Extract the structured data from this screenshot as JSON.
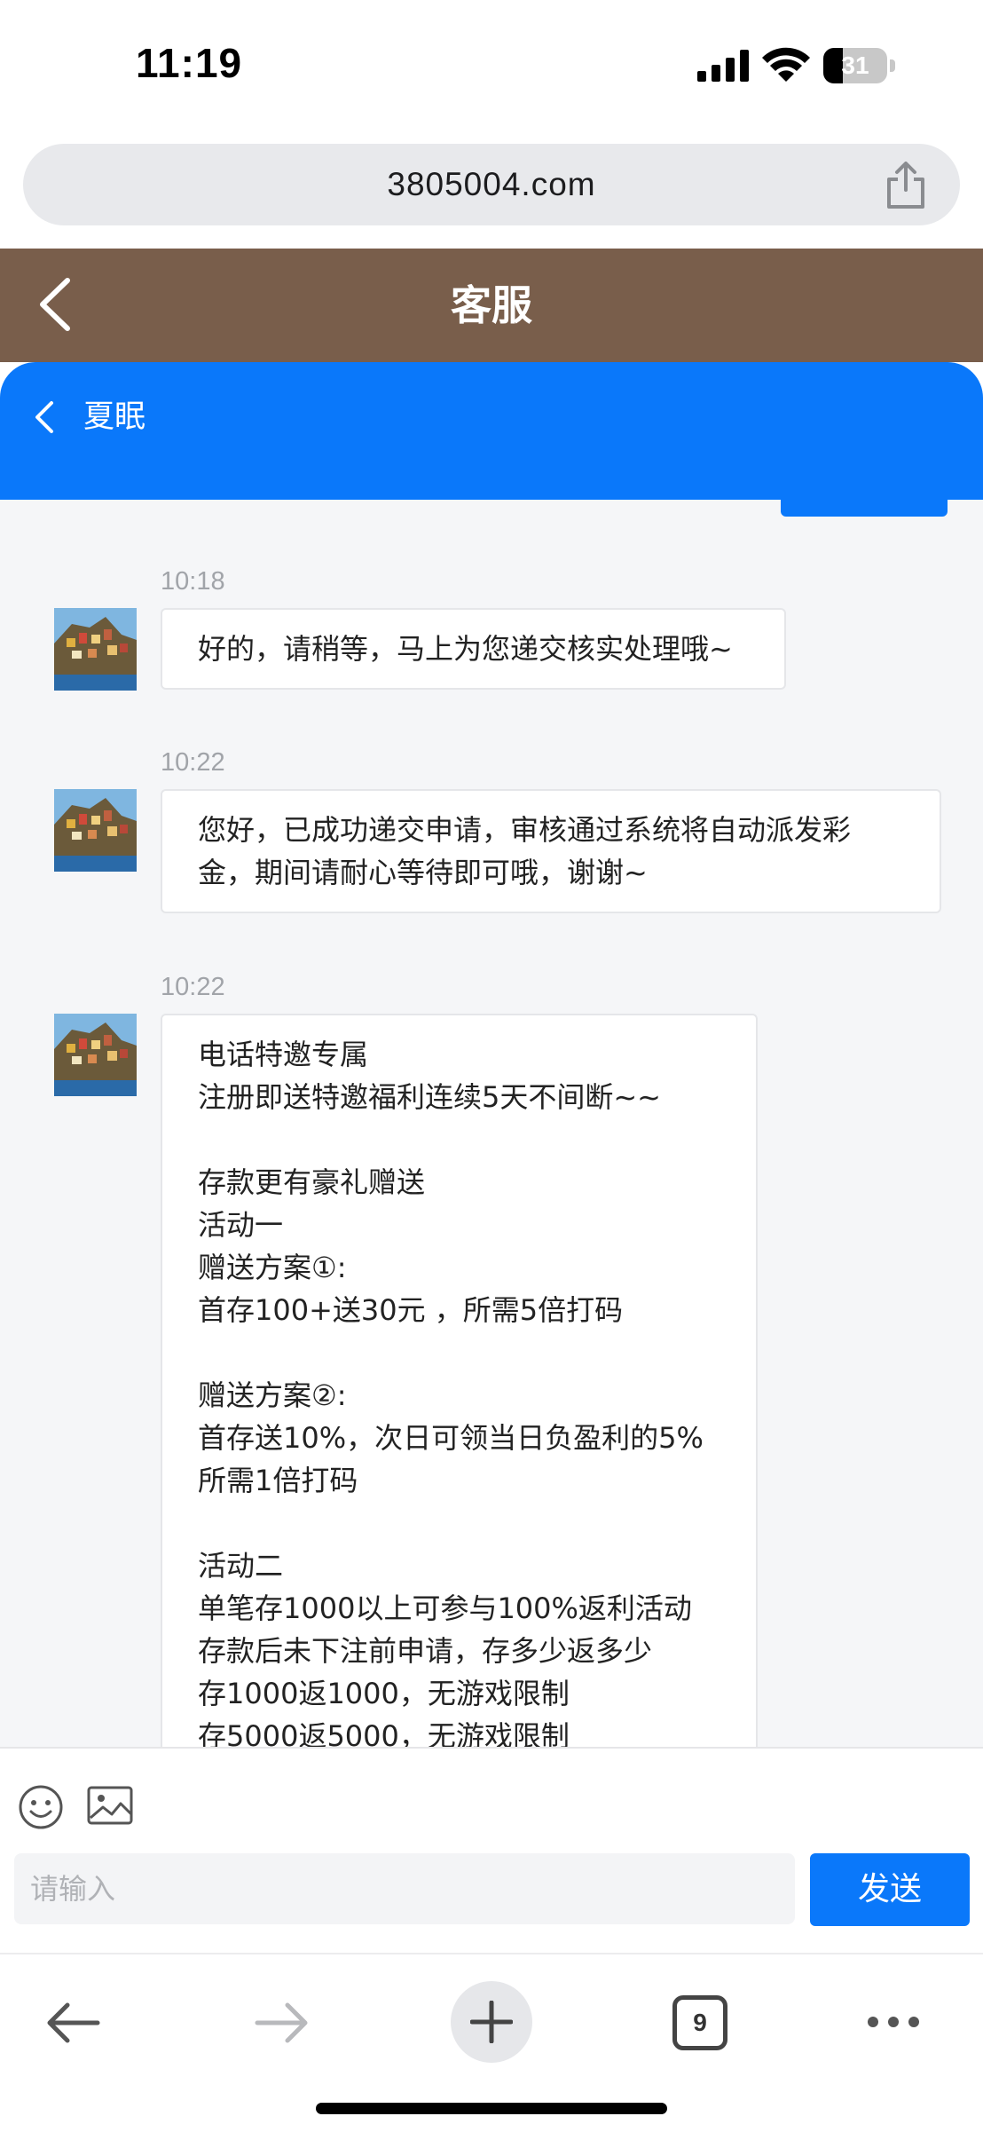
{
  "status_bar": {
    "time": "11:19",
    "battery": "31",
    "battery_level": 0.31
  },
  "browser": {
    "url": "3805004.com",
    "tab_count": "9"
  },
  "app_header": {
    "title": "客服"
  },
  "chat_header": {
    "contact_name": "夏眠"
  },
  "messages": [
    {
      "time": "10:18",
      "lines": [
        "好的，请稍等，马上为您递交核实处理哦~"
      ]
    },
    {
      "time": "10:22",
      "lines": [
        "您好，已成功递交申请，审核通过系统将自动派发彩",
        "金，期间请耐心等待即可哦，谢谢~"
      ]
    },
    {
      "time": "10:22",
      "lines": [
        "电话特邀专属",
        "注册即送特邀福利连续5天不间断~~",
        "",
        "存款更有豪礼赠送",
        "活动一",
        "赠送方案①:",
        "首存100+送30元 ，所需5倍打码",
        "",
        "赠送方案②:",
        "首存送10%，次日可领当日负盈利的5%",
        "所需1倍打码",
        "",
        "活动二",
        "单笔存1000以上可参与100%返利活动",
        "存款后未下注前申请，存多少返多少",
        "存1000返1000，无游戏限制",
        "存5000返5000，无游戏限制"
      ]
    }
  ],
  "composer": {
    "placeholder": "请输入",
    "send_label": "发送"
  },
  "colors": {
    "header_brown": "#795e4b",
    "accent_blue": "#0a78fa",
    "chat_bg": "#f5f6f8"
  },
  "icons": [
    "back-chevron-icon",
    "share-icon",
    "emoji-icon",
    "image-icon",
    "plus-icon",
    "more-icon"
  ]
}
